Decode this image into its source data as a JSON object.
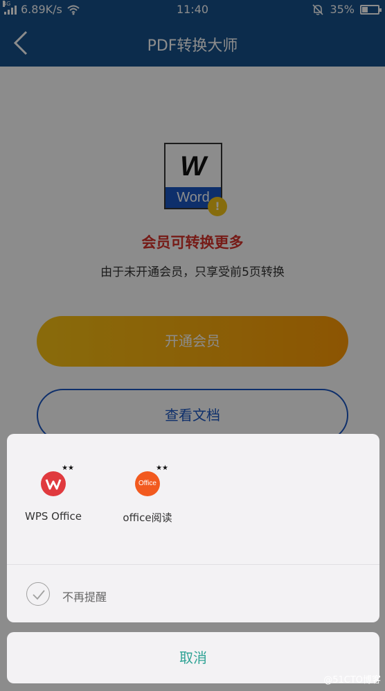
{
  "status_bar": {
    "network": "4G",
    "speed": "6.89K/s",
    "time": "11:40",
    "battery": "35%",
    "battery_level": 0.35
  },
  "header": {
    "title": "PDF转换大师"
  },
  "main": {
    "word_icon_text": "W",
    "word_icon_band": "Word",
    "warning_badge": "!",
    "headline": "会员可转换更多",
    "subtext": "由于未开通会员，只享受前5页转换",
    "member_button": "开通会员",
    "view_button": "查看文档"
  },
  "sheet": {
    "apps": [
      {
        "label": "WPS Office"
      },
      {
        "label": "office阅读",
        "icon_text": "Office"
      }
    ],
    "remind_label": "不再提醒",
    "cancel_label": "取消"
  },
  "watermark": "@51CTO博客",
  "colors": {
    "header": "#16508a",
    "headline": "#d8322a",
    "accent_blue": "#1a56c4",
    "cancel_teal": "#2fa395",
    "member_gradient_start": "#f9c315",
    "member_gradient_end": "#ff9b06"
  }
}
